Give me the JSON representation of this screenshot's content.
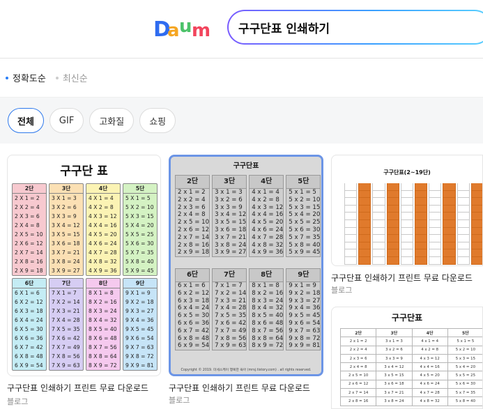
{
  "header": {
    "logo": "Daum",
    "search_value": "구구단표 인쇄하기"
  },
  "sort": [
    {
      "label": "정확도순",
      "active": true
    },
    {
      "label": "최신순",
      "active": false
    }
  ],
  "filters": [
    {
      "label": "전체",
      "active": true
    },
    {
      "label": "GIF"
    },
    {
      "label": "고화질"
    },
    {
      "label": "쇼핑"
    }
  ],
  "colors": {
    "accent": "#2f79ec",
    "logo_d": "#2f6cf0",
    "logo_a": "#f5a623",
    "logo_u": "#4cc26a",
    "logo_m": "#f2455d"
  },
  "results": [
    {
      "caption": "구구단표 인쇄하기 프린트 무료 다운로드",
      "source": "블로그",
      "image": {
        "title": "구구단 표",
        "blocks": [
          {
            "header": "2단",
            "rows": [
              "2 X 1 = 2",
              "2 X 2 = 4",
              "2 X 3 = 6",
              "2 X 4 = 8",
              "2 X 5 = 10",
              "2 X 6 = 12",
              "2 X 7 = 14",
              "2 X 8 = 16",
              "2 X 9 = 18"
            ],
            "color": "#f7c9cf"
          },
          {
            "header": "3단",
            "rows": [
              "3 X 1 = 3",
              "3 X 2 = 6",
              "3 X 3 = 9",
              "3 X 4 = 12",
              "3 X 5 = 15",
              "3 X 6 = 18",
              "3 X 7 = 21",
              "3 X 8 = 24",
              "3 X 9 = 27"
            ],
            "color": "#fbe0b4"
          },
          {
            "header": "4단",
            "rows": [
              "4 X 1 = 4",
              "4 X 2 = 8",
              "4 X 3 = 12",
              "4 X 4 = 16",
              "4 X 5 = 20",
              "4 X 6 = 24",
              "4 X 7 = 28",
              "4 X 8 = 32",
              "4 X 9 = 36"
            ],
            "color": "#fbf3b4"
          },
          {
            "header": "5단",
            "rows": [
              "5 X 1 = 5",
              "5 X 2 = 10",
              "5 X 3 = 15",
              "5 X 4 = 20",
              "5 X 5 = 25",
              "5 X 6 = 30",
              "5 X 7 = 35",
              "5 X 8 = 40",
              "5 X 9 = 45"
            ],
            "color": "#d4f2c3"
          },
          {
            "header": "6단",
            "rows": [
              "6 X 1 = 6",
              "6 X 2 = 12",
              "6 X 3 = 18",
              "6 X 4 = 24",
              "6 X 5 = 30",
              "6 X 6 = 36",
              "6 X 7 = 42",
              "6 X 8 = 48",
              "6 X 9 = 54"
            ],
            "color": "#c4ecf4"
          },
          {
            "header": "7단",
            "rows": [
              "7 X 1 = 7",
              "7 X 2 = 14",
              "7 X 3 = 21",
              "7 X 4 = 28",
              "7 X 5 = 35",
              "7 X 6 = 42",
              "7 X 7 = 49",
              "7 X 8 = 56",
              "7 X 9 = 63"
            ],
            "color": "#d6cdf3"
          },
          {
            "header": "8단",
            "rows": [
              "8 X 1 = 8",
              "8 X 2 = 16",
              "8 X 3 = 24",
              "8 X 4 = 32",
              "8 X 5 = 40",
              "8 X 6 = 48",
              "8 X 7 = 56",
              "8 X 8 = 64",
              "8 X 9 = 72"
            ],
            "color": "#f5c9ee"
          },
          {
            "header": "9단",
            "rows": [
              "9 X 1 = 9",
              "9 X 2 = 18",
              "9 X 3 = 27",
              "9 X 4 = 36",
              "9 X 5 = 45",
              "9 X 6 = 54",
              "9 X 7 = 63",
              "9 X 8 = 72",
              "9 X 9 = 81"
            ],
            "color": "#c6e4f7"
          }
        ]
      }
    },
    {
      "caption": "구구단표 인쇄하기 프린트 무료 다운로드",
      "source": "블로그",
      "image": {
        "title": "구구단표",
        "blocks": [
          {
            "header": "2단",
            "rows": [
              "2 x 1 = 2",
              "2 x 2 = 4",
              "2 x 3 = 6",
              "2 x 4 = 8",
              "2 x 5 = 10",
              "2 x 6 = 12",
              "2 x 7 = 14",
              "2 x 8 = 16",
              "2 x 9 = 18"
            ]
          },
          {
            "header": "3단",
            "rows": [
              "3 x 1 = 3",
              "3 x 2 = 6",
              "3 x 3 = 9",
              "3 x 4 = 12",
              "3 x 5 = 15",
              "3 x 6 = 18",
              "3 x 7 = 21",
              "3 x 8 = 24",
              "3 x 9 = 27"
            ]
          },
          {
            "header": "4단",
            "rows": [
              "4 x 1 = 4",
              "4 x 2 = 8",
              "4 x 3 = 12",
              "4 x 4 = 16",
              "4 x 5 = 20",
              "4 x 6 = 24",
              "4 x 7 = 28",
              "4 x 8 = 32",
              "4 x 9 = 36"
            ]
          },
          {
            "header": "5단",
            "rows": [
              "5 x 1 = 5",
              "5 x 2 = 10",
              "5 x 3 = 15",
              "5 x 4 = 20",
              "5 x 5 = 25",
              "5 x 6 = 30",
              "5 x 7 = 35",
              "5 x 8 = 40",
              "5 x 9 = 45"
            ]
          },
          {
            "header": "6단",
            "rows": [
              "6 x 1 = 6",
              "6 x 2 = 12",
              "6 x 3 = 18",
              "6 x 4 = 24",
              "6 x 5 = 30",
              "6 x 6 = 36",
              "6 x 7 = 42",
              "6 x 8 = 48",
              "6 x 9 = 54"
            ]
          },
          {
            "header": "7단",
            "rows": [
              "7 x 1 = 7",
              "7 x 2 = 14",
              "7 x 3 = 21",
              "7 x 4 = 28",
              "7 x 5 = 35",
              "7 x 6 = 42",
              "7 x 7 = 49",
              "7 x 8 = 56",
              "7 x 9 = 63"
            ]
          },
          {
            "header": "8단",
            "rows": [
              "8 x 1 = 8",
              "8 x 2 = 16",
              "8 x 3 = 24",
              "8 x 4 = 32",
              "8 x 5 = 40",
              "8 x 6 = 48",
              "8 x 7 = 56",
              "8 x 8 = 64",
              "8 x 9 = 72"
            ]
          },
          {
            "header": "9단",
            "rows": [
              "9 x 1 = 9",
              "9 x 2 = 18",
              "9 x 3 = 27",
              "9 x 4 = 36",
              "9 x 5 = 45",
              "9 x 6 = 54",
              "9 x 7 = 63",
              "9 x 8 = 72",
              "9 x 9 = 81"
            ]
          }
        ],
        "copyright": "Copyright © 2019. 미세스케이 행복한 육아 (mrsj.tistory.com) . all rights reserved."
      }
    },
    {
      "caption": "구구단표 인쇄하기 프린트 무료 다운로드",
      "source": "블로그",
      "image": {
        "title": "구구단표(2~19단)"
      }
    },
    {
      "caption": "",
      "source": "",
      "image": {
        "title": "구구단표",
        "headers": [
          "2단",
          "3단",
          "4단",
          "5단"
        ],
        "rows": [
          [
            "2 x 1 = 2",
            "3 x 1 = 3",
            "4 x 1 = 4",
            "5 x 1 = 5"
          ],
          [
            "2 x 2 = 4",
            "3 x 2 = 6",
            "4 x 2 = 8",
            "5 x 2 = 10"
          ],
          [
            "2 x 3 = 6",
            "3 x 3 = 9",
            "4 x 3 = 12",
            "5 x 3 = 15"
          ],
          [
            "2 x 4 = 8",
            "3 x 4 = 12",
            "4 x 4 = 16",
            "5 x 4 = 20"
          ],
          [
            "2 x 5 = 10",
            "3 x 5 = 15",
            "4 x 5 = 20",
            "5 x 5 = 25"
          ],
          [
            "2 x 6 = 12",
            "3 x 6 = 18",
            "4 x 6 = 24",
            "5 x 6 = 30"
          ],
          [
            "2 x 7 = 14",
            "3 x 7 = 21",
            "4 x 7 = 28",
            "5 x 7 = 35"
          ],
          [
            "2 x 8 = 16",
            "3 x 8 = 24",
            "4 x 8 = 32",
            "5 x 8 = 40"
          ]
        ]
      }
    }
  ]
}
